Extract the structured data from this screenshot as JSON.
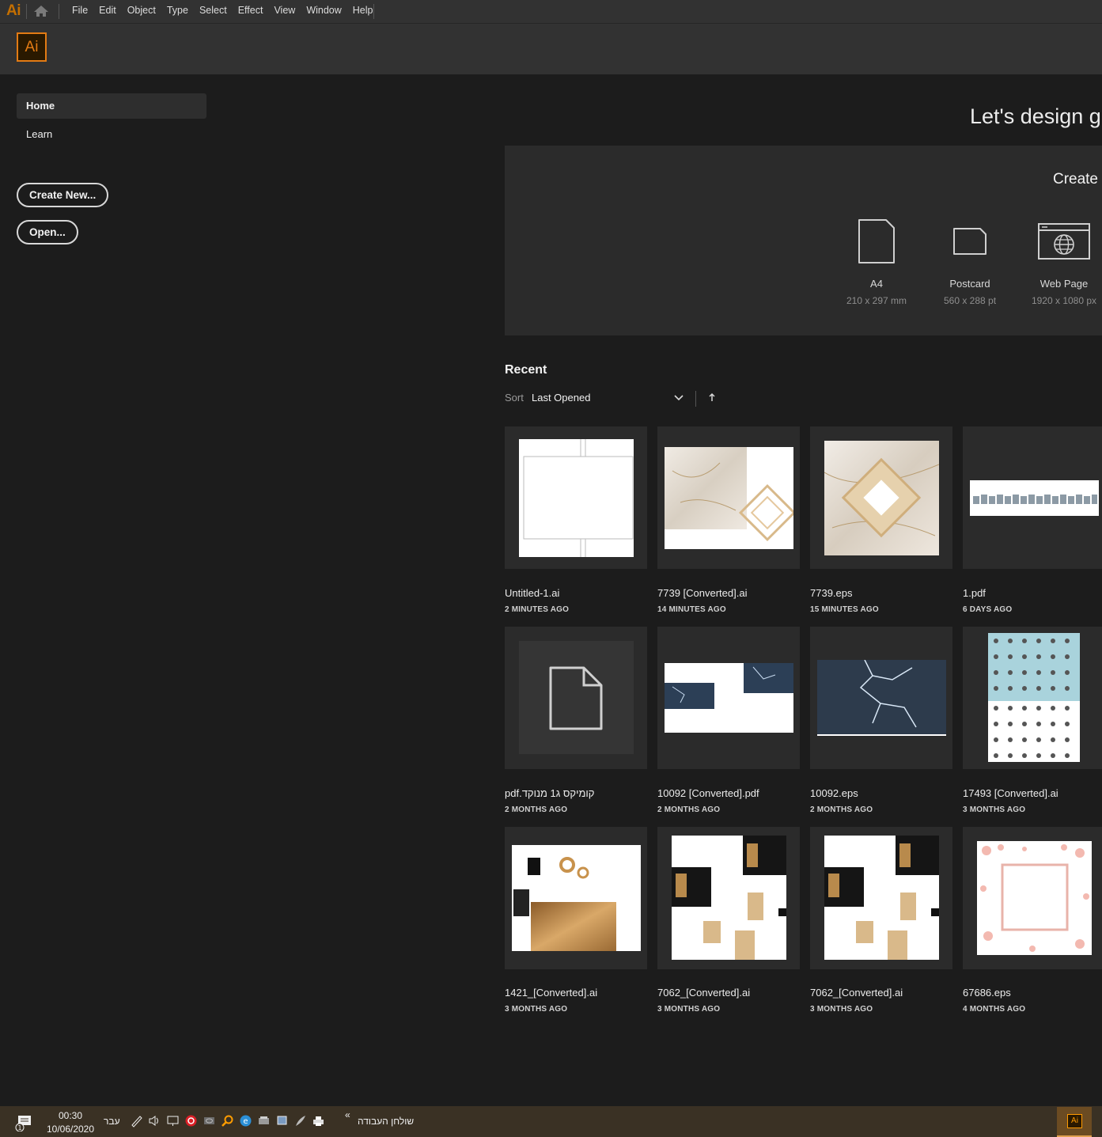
{
  "app": {
    "logo": "Ai",
    "badge": "Ai"
  },
  "menu": [
    "File",
    "Edit",
    "Object",
    "Type",
    "Select",
    "Effect",
    "View",
    "Window",
    "Help"
  ],
  "sidebar": {
    "items": [
      {
        "label": "Home"
      },
      {
        "label": "Learn"
      }
    ],
    "create_new": "Create New...",
    "open": "Open..."
  },
  "hero": "Let's design gre",
  "create": {
    "title": "Create",
    "presets": [
      {
        "name": "A4",
        "size": "210 x 297 mm",
        "icon": "document-icon"
      },
      {
        "name": "Postcard",
        "size": "560 x 288 pt",
        "icon": "postcard-icon"
      },
      {
        "name": "Web Page",
        "size": "1920 x 1080 px",
        "icon": "web-page-icon"
      }
    ]
  },
  "recent": {
    "title": "Recent",
    "sort_label": "Sort",
    "sort_value": "Last Opened",
    "files": [
      {
        "name": "Untitled-1.ai",
        "time": "2 MINUTES AGO"
      },
      {
        "name": "7739 [Converted].ai",
        "time": "14 MINUTES AGO"
      },
      {
        "name": "7739.eps",
        "time": "15 MINUTES AGO"
      },
      {
        "name": "1.pdf",
        "time": "6 DAYS AGO"
      },
      {
        "name": "קומיקס ג1 מנוקד.pdf",
        "time": "2 MONTHS AGO"
      },
      {
        "name": "10092 [Converted].pdf",
        "time": "2 MONTHS AGO"
      },
      {
        "name": "10092.eps",
        "time": "2 MONTHS AGO"
      },
      {
        "name": "17493 [Converted].ai",
        "time": "3 MONTHS AGO"
      },
      {
        "name": "1421_[Converted].ai",
        "time": "3 MONTHS AGO"
      },
      {
        "name": "7062_[Converted].ai",
        "time": "3 MONTHS AGO"
      },
      {
        "name": "7062_[Converted].ai",
        "time": "3 MONTHS AGO"
      },
      {
        "name": "67686.eps",
        "time": "4 MONTHS AGO"
      }
    ]
  },
  "taskbar": {
    "time": "00:30",
    "date": "10/06/2020",
    "lang": "עבר",
    "desktop": "שולחן העבודה",
    "chevrons": "«",
    "notif_count": "1",
    "ai_label": "Ai"
  },
  "colors": {
    "accent": "#e37b14",
    "bg": "#1c1c1c",
    "panel": "#2b2b2b",
    "header": "#323232"
  }
}
